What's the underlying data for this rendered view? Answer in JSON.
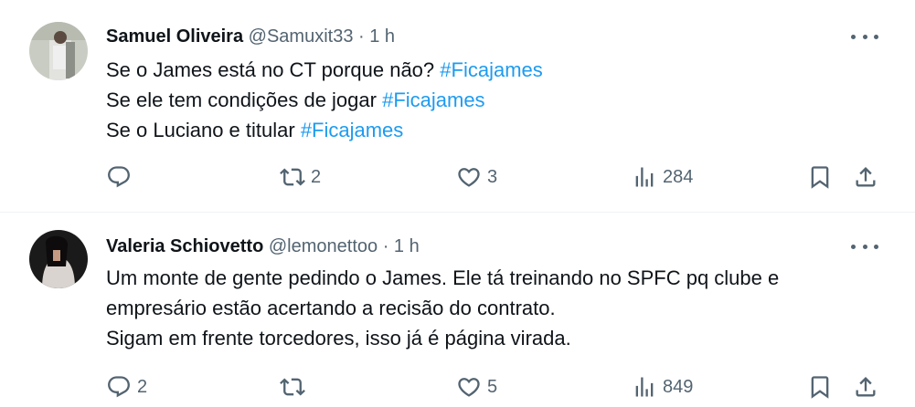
{
  "tweets": [
    {
      "name": "Samuel Oliveira",
      "handle": "@Samuxit33",
      "separator": "·",
      "time": "1 h",
      "lines": [
        {
          "text": "Se o James está no CT porque não? ",
          "tag": "#Ficajames"
        },
        {
          "text": "Se ele tem condições de jogar ",
          "tag": "#Ficajames"
        },
        {
          "text": "Se o Luciano e titular ",
          "tag": "#Ficajames"
        }
      ],
      "replies": "",
      "retweets": "2",
      "likes": "3",
      "views": "284"
    },
    {
      "name": "Valeria Schiovetto",
      "handle": "@lemonettoo",
      "separator": "·",
      "time": "1 h",
      "lines": [
        {
          "text": "Um monte de gente pedindo o James. Ele tá treinando no SPFC pq clube e"
        },
        {
          "text": "empresário estão acertando a recisão do contrato."
        },
        {
          "text": "Sigam em frente torcedores, isso já é página virada."
        }
      ],
      "replies": "2",
      "retweets": "",
      "likes": "5",
      "views": "849"
    }
  ],
  "icons": {
    "reply": "reply-icon",
    "retweet": "retweet-icon",
    "like": "heart-icon",
    "views": "views-icon",
    "bookmark": "bookmark-icon",
    "share": "share-icon",
    "more": "more-icon"
  },
  "colors": {
    "text": "#0f1419",
    "secondary": "#536471",
    "hashtag": "#1d9bf0",
    "divider": "#eff3f4"
  }
}
